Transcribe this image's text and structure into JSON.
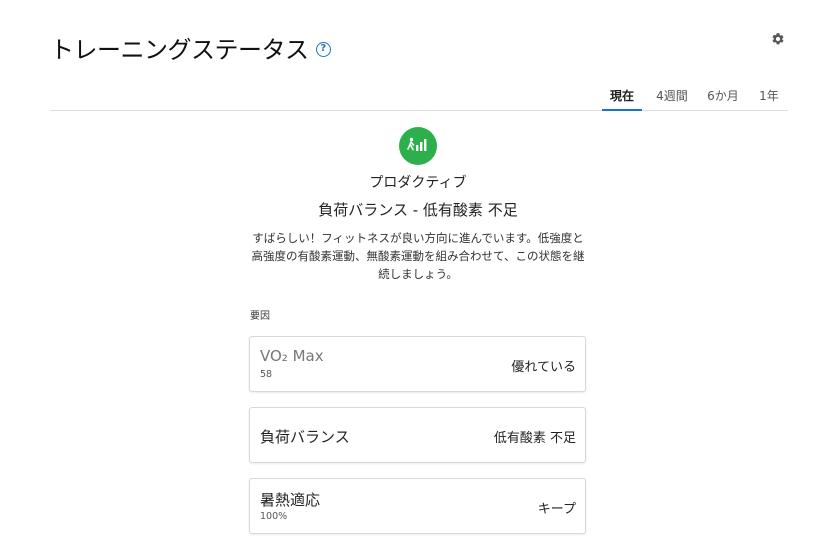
{
  "header": {
    "title": "トレーニングステータス",
    "help_glyph": "?"
  },
  "tabs": [
    {
      "label": "現在",
      "active": true
    },
    {
      "label": "4週間",
      "active": false
    },
    {
      "label": "6か月",
      "active": false
    },
    {
      "label": "1年",
      "active": false
    }
  ],
  "status": {
    "name": "プロダクティブ",
    "sub": "負荷バランス - 低有酸素 不足",
    "description": "すばらしい！フィットネスが良い方向に進んでいます。低強度と高強度の有酸素運動、無酸素運動を組み合わせて、この状態を継続しましょう。",
    "color": "#2db04b"
  },
  "factors": {
    "label": "要因",
    "items": [
      {
        "name": "VO₂ Max",
        "small": "58",
        "value": "優れている"
      },
      {
        "name": "負荷バランス",
        "small": "",
        "value": "低有酸素 不足"
      },
      {
        "name": "暑熱適応",
        "small": "100%",
        "value": "キープ"
      }
    ]
  },
  "colors": {
    "accent": "#1a73c8",
    "status_green": "#2db04b"
  }
}
